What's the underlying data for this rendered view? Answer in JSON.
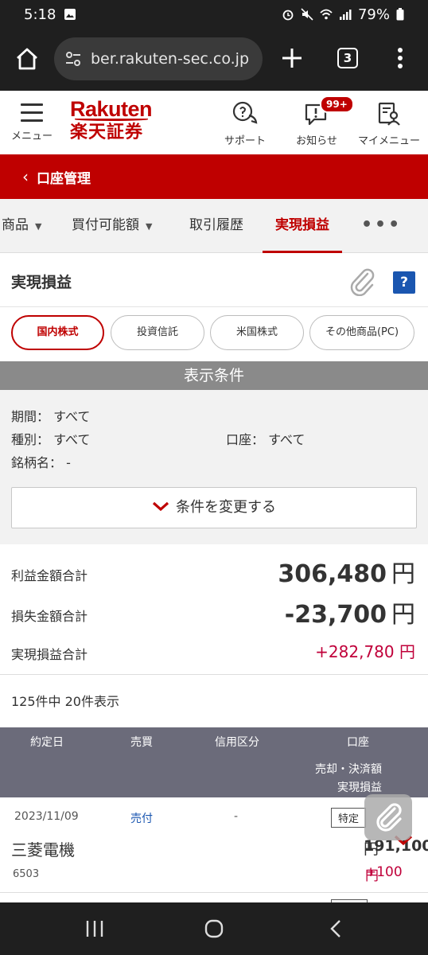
{
  "status_bar": {
    "time": "5:18",
    "battery": "79%"
  },
  "browser": {
    "url": "ber.rakuten-sec.co.jp",
    "tab_count": "3"
  },
  "site_header": {
    "menu_label": "メニュー",
    "logo_en": "Rakuten",
    "logo_ja": "楽天証券",
    "support_label": "サポート",
    "notice_label": "お知らせ",
    "notice_badge": "99+",
    "mymenu_label": "マイメニュー"
  },
  "breadcrumb": {
    "back": "‹",
    "title": "口座管理"
  },
  "subnav": {
    "items": [
      {
        "label": "商品"
      },
      {
        "label": "買付可能額"
      },
      {
        "label": "取引履歴"
      },
      {
        "label": "実現損益"
      }
    ],
    "more": "•••"
  },
  "section": {
    "title": "実現損益",
    "help": "?"
  },
  "filters": [
    {
      "label": "国内株式",
      "selected": true
    },
    {
      "label": "投資信託",
      "selected": false
    },
    {
      "label": "米国株式",
      "selected": false
    },
    {
      "label": "その他商品(PC)",
      "selected": false
    }
  ],
  "conditions": {
    "header": "表示条件",
    "period_label": "期間：",
    "period_value": "すべて",
    "type_label": "種別：",
    "type_value": "すべて",
    "account_label": "口座：",
    "account_value": "すべて",
    "name_label": "銘柄名：",
    "name_value": "-",
    "change_button": "条件を変更する"
  },
  "summary": {
    "profit_label": "利益金額合計",
    "profit_value": "306,480",
    "loss_label": "損失金額合計",
    "loss_value": "-23,700",
    "total_label": "実現損益合計",
    "total_value": "+282,780",
    "yen": "円"
  },
  "count_text": "125件中 20件表示",
  "table": {
    "headers": {
      "date": "約定日",
      "trade": "売買",
      "margin": "信用区分",
      "account": "口座",
      "settle": "売却・決済額",
      "pnl": "実現損益"
    },
    "rows": [
      {
        "date": "2023/11/09",
        "trade": "売付",
        "margin": "-",
        "account": "特定",
        "name": "三菱電機",
        "code": "6503",
        "amount": "191,100",
        "pnl": "+100",
        "yen": "円"
      }
    ]
  },
  "colors": {
    "brand_red": "#bf0000",
    "profit_red": "#c0003a",
    "link_blue": "#1a56b0"
  }
}
